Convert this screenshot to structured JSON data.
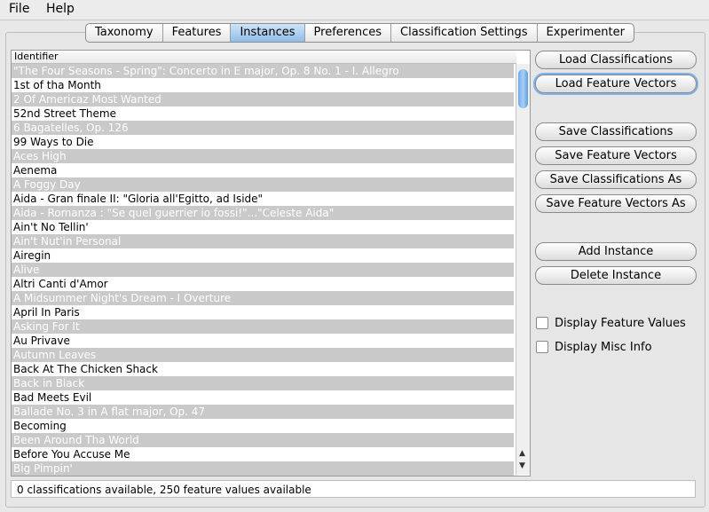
{
  "menu": [
    "File",
    "Help"
  ],
  "tabs": [
    {
      "label": "Taxonomy"
    },
    {
      "label": "Features"
    },
    {
      "label": "Instances",
      "active": true
    },
    {
      "label": "Preferences"
    },
    {
      "label": "Classification Settings"
    },
    {
      "label": "Experimenter"
    }
  ],
  "table": {
    "header": "Identifier",
    "rows": [
      "\"The Four Seasons - Spring\": Concerto in E major, Op. 8 No. 1 - I. Allegro",
      "1st of tha Month",
      "2 Of Americaz Most Wanted",
      "52nd Street Theme",
      "6 Bagatelles, Op. 126",
      "99 Ways to Die",
      "Aces High",
      "Aenema",
      "A Foggy Day",
      "Aida - Gran finale II: \"Gloria all'Egitto, ad Iside\"",
      "Aida - Romanza : \"Se quel guerrier io fossi!\"...\"Celeste Aida\"",
      "Ain't No Tellin'",
      "Ain't Nut'in Personal",
      "Airegin",
      "Alive",
      "Altri Canti d'Amor",
      "A Midsummer Night's Dream - I Overture",
      "April In Paris",
      "Asking For It",
      "Au Privave",
      "Autumn Leaves",
      "Back At The Chicken Shack",
      "Back in Black",
      "Bad Meets Evil",
      "Ballade No. 3 in A flat major, Op. 47",
      "Becoming",
      "Been Around Tha World",
      "Before You Accuse Me",
      "Big Pimpin'"
    ]
  },
  "buttons": {
    "load_classifications": "Load Classifications",
    "load_feature_vectors": "Load Feature Vectors",
    "save_classifications": "Save Classifications",
    "save_feature_vectors": "Save Feature Vectors",
    "save_classifications_as": "Save Classifications As",
    "save_feature_vectors_as": "Save Feature Vectors As",
    "add_instance": "Add Instance",
    "delete_instance": "Delete Instance"
  },
  "checkboxes": {
    "display_feature_values": "Display Feature Values",
    "display_misc_info": "Display Misc Info"
  },
  "status": "0 classifications available, 250 feature values available"
}
